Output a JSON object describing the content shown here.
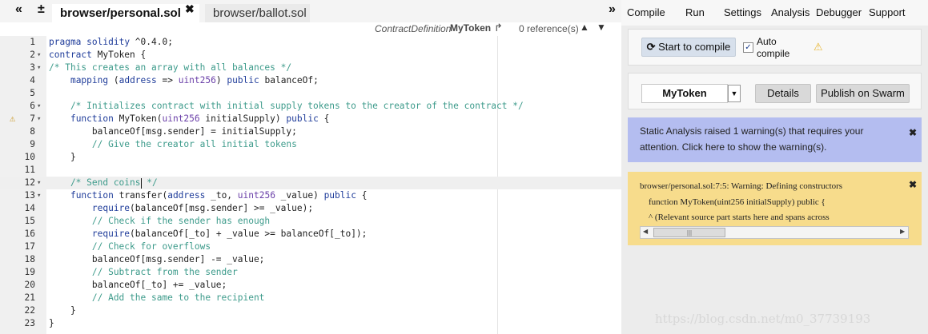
{
  "tabbar": {
    "collapse_left": "«",
    "add_file": "±",
    "tabs": [
      {
        "label": "browser/personal.sol",
        "close": "✖"
      },
      {
        "label": "browser/ballot.sol"
      }
    ],
    "expand_right": "»"
  },
  "editor_header": {
    "context_kind": "ContractDefinition",
    "context_name": "MyToken",
    "goto_icon": "↱",
    "references": "0 reference(s)",
    "up": "▲",
    "down": "▼"
  },
  "code": {
    "lines": [
      {
        "n": "1",
        "fold": "",
        "text": "pragma solidity ^0.4.0;"
      },
      {
        "n": "2",
        "fold": "▾",
        "text": "contract MyToken {"
      },
      {
        "n": "3",
        "fold": "▾",
        "text": "/* This creates an array with all balances */"
      },
      {
        "n": "4",
        "fold": "",
        "text": "    mapping (address => uint256) public balanceOf;"
      },
      {
        "n": "5",
        "fold": "",
        "text": ""
      },
      {
        "n": "6",
        "fold": "▾",
        "text": "    /* Initializes contract with initial supply tokens to the creator of the contract */"
      },
      {
        "n": "7",
        "fold": "▾",
        "text": "    function MyToken(uint256 initialSupply) public {",
        "warn": true
      },
      {
        "n": "8",
        "fold": "",
        "text": "        balanceOf[msg.sender] = initialSupply;"
      },
      {
        "n": "9",
        "fold": "",
        "text": "        // Give the creator all initial tokens"
      },
      {
        "n": "10",
        "fold": "",
        "text": "    }"
      },
      {
        "n": "11",
        "fold": "",
        "text": ""
      },
      {
        "n": "12",
        "fold": "▾",
        "text": "    /* Send coins */",
        "highlight": true
      },
      {
        "n": "13",
        "fold": "▾",
        "text": "    function transfer(address _to, uint256 _value) public {"
      },
      {
        "n": "14",
        "fold": "",
        "text": "        require(balanceOf[msg.sender] >= _value);"
      },
      {
        "n": "15",
        "fold": "",
        "text": "        // Check if the sender has enough"
      },
      {
        "n": "16",
        "fold": "",
        "text": "        require(balanceOf[_to] + _value >= balanceOf[_to]);"
      },
      {
        "n": "17",
        "fold": "",
        "text": "        // Check for overflows"
      },
      {
        "n": "18",
        "fold": "",
        "text": "        balanceOf[msg.sender] -= _value;"
      },
      {
        "n": "19",
        "fold": "",
        "text": "        // Subtract from the sender"
      },
      {
        "n": "20",
        "fold": "",
        "text": "        balanceOf[_to] += _value;"
      },
      {
        "n": "21",
        "fold": "",
        "text": "        // Add the same to the recipient"
      },
      {
        "n": "22",
        "fold": "",
        "text": "    }"
      },
      {
        "n": "23",
        "fold": "",
        "text": "}"
      }
    ],
    "warning_icon": "⚠"
  },
  "right_panel": {
    "menu": [
      "Compile",
      "Run",
      "Settings",
      "Analysis",
      "Debugger",
      "Support"
    ],
    "compile": {
      "button": "Start to compile",
      "refresh_icon": "⟳",
      "auto_compile_checked": "✓",
      "auto_compile_label_1": "Auto",
      "auto_compile_label_2": "compile",
      "warning_icon": "⚠"
    },
    "contract": {
      "selected": "MyToken",
      "dropdown_arrow": "▼",
      "details": "Details",
      "publish": "Publish on Swarm"
    },
    "static_analysis": {
      "line1": "Static Analysis raised 1 warning(s) that requires your",
      "line2": "attention. Click here to show the warning(s).",
      "close": "✖"
    },
    "warning": {
      "line1": "browser/personal.sol:7:5: Warning: Defining constructors",
      "line2": "    function MyToken(uint256 initialSupply) public {",
      "line3": "    ^ (Relevant source part starts here and spans across",
      "close": "✖",
      "scroll_left": "◀",
      "scroll_right": "▶",
      "thumb_grip": "|||"
    }
  },
  "watermark": "https://blog.csdn.net/m0_37739193",
  "colors": {
    "accent_button": "#d7e0ec",
    "info_bg": "#b4bdf0",
    "warning_bg": "#f7dc8c",
    "keyword": "#1f3c9a",
    "comment": "#3d9b8b"
  }
}
